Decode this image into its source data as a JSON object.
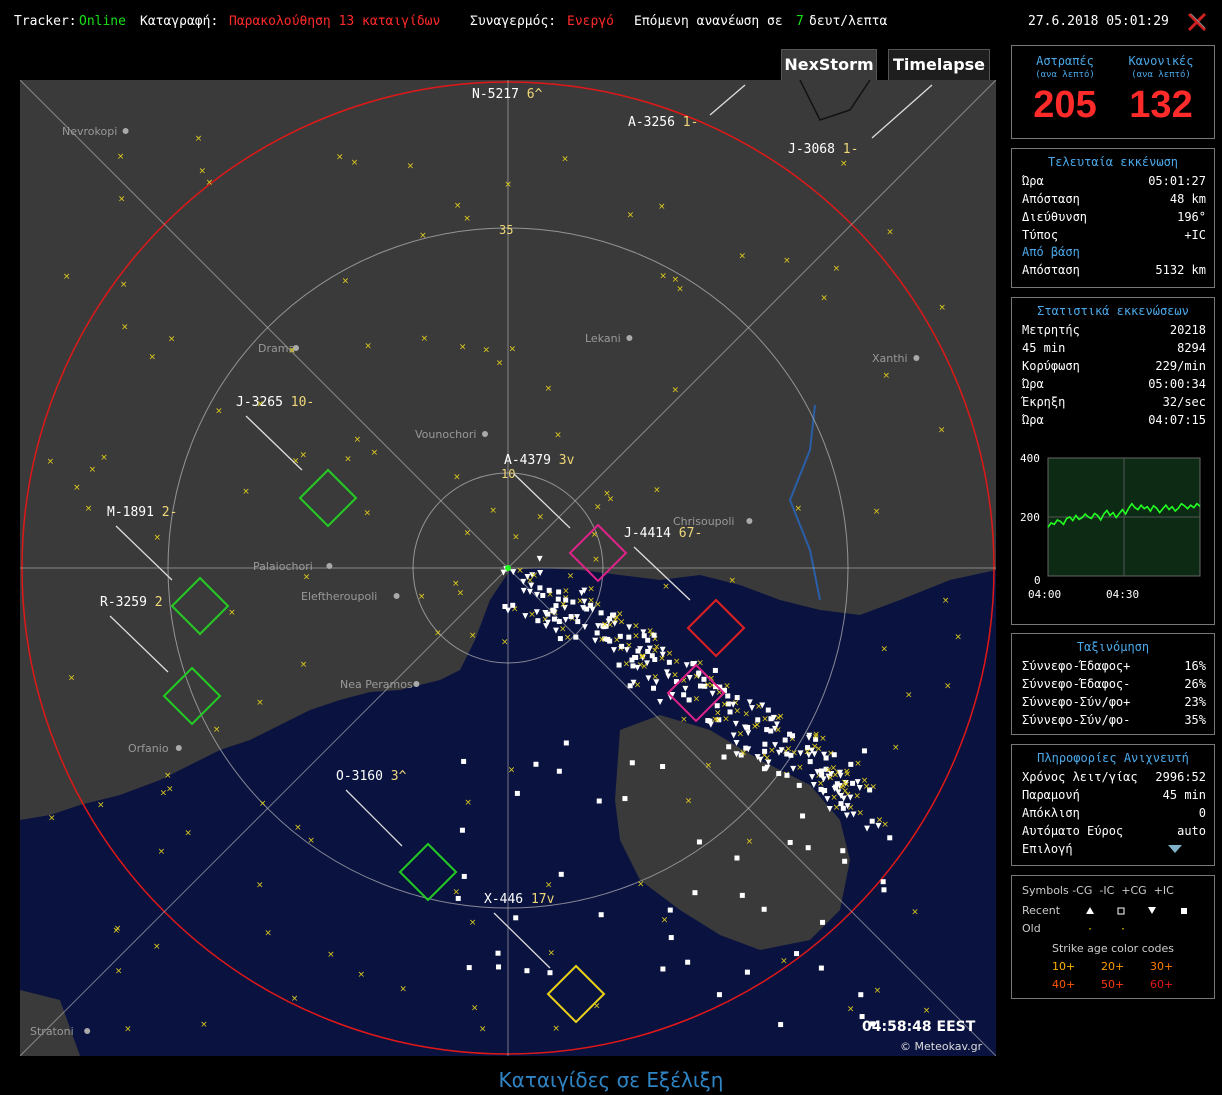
{
  "topbar": {
    "tracker_label": "Tracker:",
    "tracker_value": "Online",
    "recording_label": "Καταγραφή:",
    "recording_value": "Παρακολούθηση 13 καταιγίδων",
    "alarm_label": "Συναγερμός:",
    "alarm_value": "Ενεργό",
    "refresh_prefix": "Επόμενη ανανέωση σε",
    "refresh_seconds": "7",
    "refresh_suffix": "δευτ/λεπτα",
    "datetime": "27.6.2018 05:01:29"
  },
  "tabs": [
    {
      "label": "NexStorm"
    },
    {
      "label": "Timelapse"
    }
  ],
  "counts": {
    "strikes_label": "Αστραπές",
    "strikes_sub": "(ανα λεπτό)",
    "strikes_value": "205",
    "noise_label": "Κανονικές",
    "noise_sub": "(ανα λεπτό)",
    "noise_value": "132"
  },
  "last_strike": {
    "title": "Τελευταία εκκένωση",
    "rows": [
      {
        "label": "Ώρα",
        "value": "05:01:27"
      },
      {
        "label": "Απόσταση",
        "value": "48 km"
      },
      {
        "label": "Διεύθυνση",
        "value": "196°"
      },
      {
        "label": "Τύπος",
        "value": "+IC"
      }
    ],
    "base_title": "Από βάση",
    "base_rows": [
      {
        "label": "Απόσταση",
        "value": "5132 km"
      }
    ]
  },
  "stats": {
    "title": "Στατιστικά εκκενώσεων",
    "rows": [
      {
        "label": "Μετρητής",
        "value": "20218"
      },
      {
        "label": "45 min",
        "value": "8294"
      },
      {
        "label": "Κορύφωση",
        "value": "229/min"
      },
      {
        "label": "Ώρα",
        "value": "05:00:34"
      },
      {
        "label": "Έκρηξη",
        "value": "32/sec"
      },
      {
        "label": "Ώρα",
        "value": "04:07:15"
      }
    ]
  },
  "rate_chart": {
    "y_labels": [
      "400",
      "200",
      "0"
    ],
    "x_labels": [
      "04:00",
      "04:30"
    ]
  },
  "chart_data": {
    "type": "line",
    "ylim": [
      0,
      400
    ],
    "x_labels": [
      "04:00",
      "04:30"
    ],
    "series": [
      {
        "values": [
          165,
          180,
          175,
          190,
          185,
          175,
          195,
          200,
          188,
          205,
          192,
          198,
          210,
          200,
          195,
          212,
          205,
          190,
          210,
          222,
          205,
          215,
          198,
          212,
          225,
          210,
          230,
          245,
          232,
          225,
          240,
          228,
          235,
          220,
          238,
          230,
          215,
          228,
          240,
          225,
          235,
          220,
          230,
          245,
          238,
          228,
          240,
          232,
          245,
          236
        ]
      }
    ]
  },
  "classification": {
    "title": "Ταξινόμηση",
    "rows": [
      {
        "label": "Σύννεφο-Έδαφος+",
        "value": "16%"
      },
      {
        "label": "Σύννεφο-Έδαφος-",
        "value": "26%"
      },
      {
        "label": "Σύννεφο-Σύν/φο+",
        "value": "23%"
      },
      {
        "label": "Σύννεφο-Σύν/φο-",
        "value": "35%"
      }
    ]
  },
  "detector": {
    "title": "Πληροφορίες Ανιχνευτή",
    "rows": [
      {
        "label": "Χρόνος λειτ/γίας",
        "value": "2996:52"
      },
      {
        "label": "Παραμονή",
        "value": "45 min"
      },
      {
        "label": "Απόκλιση",
        "value": "0"
      },
      {
        "label": "Αυτόματο Εύρος",
        "value": "auto"
      },
      {
        "label": "Επιλογή",
        "value": ""
      }
    ]
  },
  "legend": {
    "header": "Symbols -CG  -IC  +CG  +IC",
    "recent": "Recent",
    "old": "Old",
    "age_title": "Strike age color codes",
    "ages": [
      {
        "label": "10+",
        "color": "#ffb300"
      },
      {
        "label": "20+",
        "color": "#ff9900"
      },
      {
        "label": "30+",
        "color": "#ff7a00"
      },
      {
        "label": "40+",
        "color": "#ff5a00"
      },
      {
        "label": "50+",
        "color": "#ff3a10"
      },
      {
        "label": "60+",
        "color": "#e01a1a"
      }
    ]
  },
  "map": {
    "range_label": "35",
    "inner_range_label": "10",
    "timestamp": "04:58:48 EEST",
    "copyright": "© Meteokav.gr",
    "cities": [
      "Nevrokopi",
      "Drama",
      "Lekani",
      "Xanthi",
      "Vounochori",
      "Palaiochori",
      "Eleftheroupoli",
      "Nea Peramos",
      "Orfanio",
      "Chrisoupoli",
      "Stratoni"
    ],
    "storms": [
      {
        "id": "N-5217",
        "suffix": "6^",
        "color": "#ffffff"
      },
      {
        "id": "A-3256",
        "suffix": "1-",
        "color": "#ffffff"
      },
      {
        "id": "J-3068",
        "suffix": "1-",
        "color": "#ffffff"
      },
      {
        "id": "J-3265",
        "suffix": "10-",
        "color": "#ffffff"
      },
      {
        "id": "M-1891",
        "suffix": "2-",
        "color": "#ffffff"
      },
      {
        "id": "R-3259",
        "suffix": "2",
        "color": "#ffffff"
      },
      {
        "id": "A-4379",
        "suffix": "3v",
        "color": "#ffffff"
      },
      {
        "id": "J-4414",
        "suffix": "67-",
        "color": "#ffffff"
      },
      {
        "id": "O-3160",
        "suffix": "3^",
        "color": "#ffffff"
      },
      {
        "id": "X-446",
        "suffix": "17v",
        "color": "#ffffff"
      }
    ]
  },
  "footer": {
    "title": "Καταιγίδες σε Εξέλιξη"
  },
  "colors": {
    "online": "#19e019",
    "alert": "#ff2a2a",
    "accent_blue": "#4aa8e8",
    "sea": "#0a1240",
    "land": "#3a3a3a",
    "range_ring": "#e01818"
  }
}
